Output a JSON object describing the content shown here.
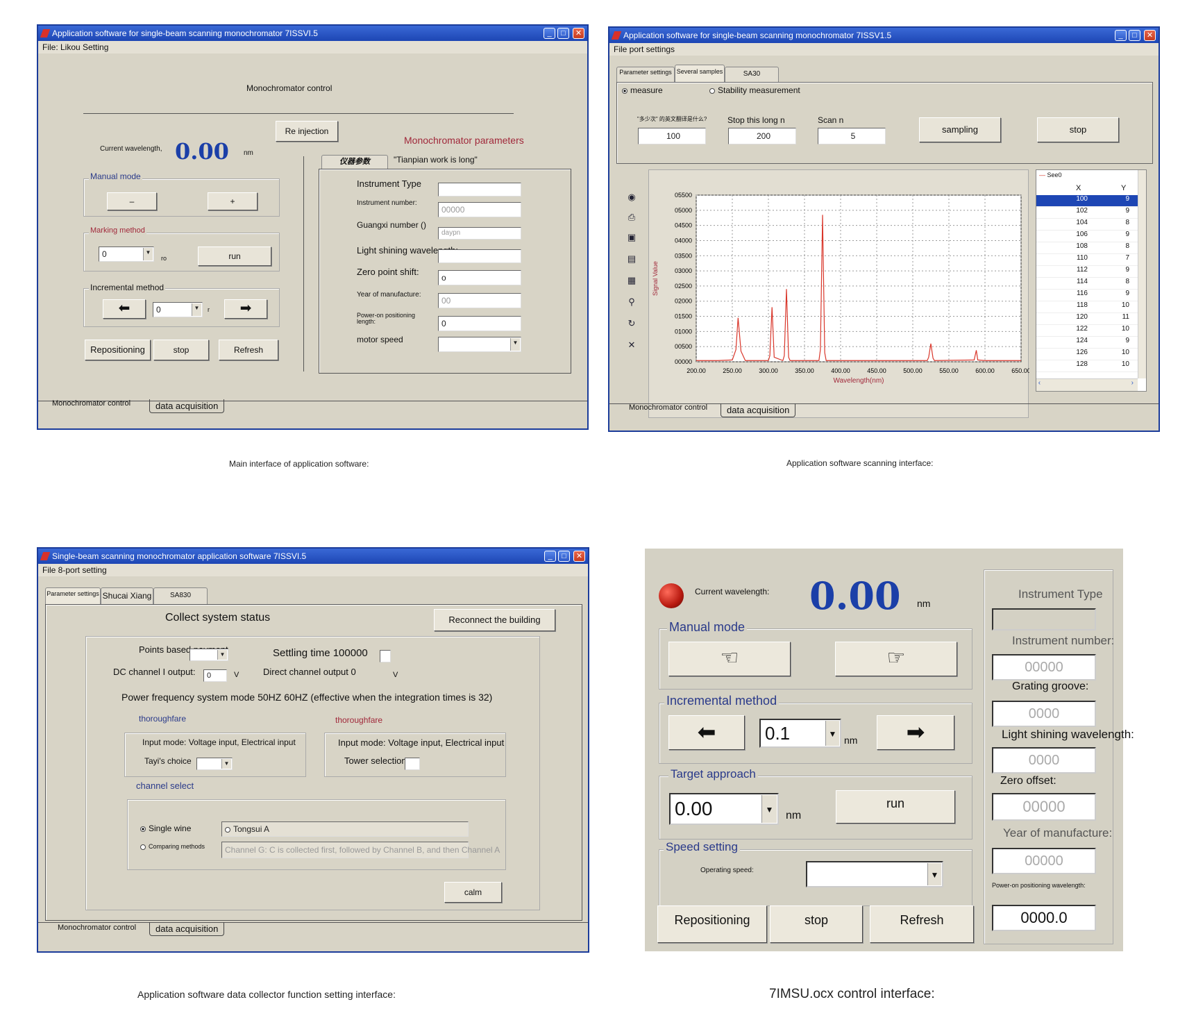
{
  "colors": {
    "titlebar": "#1d46b4",
    "wavelength": "#1b3fa8",
    "param_red": "#a0283a",
    "spectrum": "#d9362a",
    "group_blue": "#2a3a8a"
  },
  "panel1": {
    "title": "Application software for single-beam scanning monochromator 7ISSVI.5",
    "menu": "File: Likou Setting",
    "heading": "Monochromator control",
    "reinjection": "Re injection",
    "current_wavelength_label": "Current wavelength,",
    "wavelength_value": "0.00",
    "wavelength_unit": "nm",
    "manual_mode": "Manual mode",
    "minus": "–",
    "plus": "+",
    "marking_method": "Marking method",
    "marking_value": "0",
    "marking_unit": "ro",
    "run": "run",
    "incremental_method": "Incremental method",
    "incremental_value": "0",
    "incremental_unit": "r",
    "repositioning": "Repositioning",
    "stop": "stop",
    "refresh": "Refresh",
    "params_title": "Monochromator parameters",
    "tab_active": "仪器参数",
    "tab_other": "\"Tianpian work is long\"",
    "instrument_type": "Instrument Type",
    "instrument_number": "Instrument number:",
    "instrument_number_value": "00000",
    "guangxi_number": "Guangxi number ()",
    "guangxi_value": "daypn",
    "light_shining": "Light shining wavelength:",
    "zero_point": "Zero point shift:",
    "zero_point_value": "o",
    "year": "Year of manufacture:",
    "year_value": "00",
    "power_on": "Power-on positioning length:",
    "power_on_value": "0",
    "motor_speed": "motor speed",
    "bottom_tab1": "Monochromator control",
    "bottom_tab2": "data acquisition"
  },
  "caption1": "Main interface of application software:",
  "panel2": {
    "title": "Application software for single-beam scanning monochromator 7ISSV1.5",
    "menu": "File port settings",
    "tab1": "Parameter settings",
    "tab2": "Several samples",
    "tab3": "SA30",
    "radio_measure": "measure",
    "radio_stability": "Stability measurement",
    "field1_label": "\"多少次\" 的英文翻译是什么?",
    "field1_value": "100",
    "field2_label": "Stop this long n",
    "field2_value": "200",
    "field3_label": "Scan n",
    "field3_value": "5",
    "sampling": "sampling",
    "stop": "stop",
    "table_series": "See0",
    "table_col_x": "X",
    "table_col_y": "Y",
    "table_rows": [
      {
        "x": "100",
        "y": "9"
      },
      {
        "x": "102",
        "y": "9"
      },
      {
        "x": "104",
        "y": "8"
      },
      {
        "x": "106",
        "y": "9"
      },
      {
        "x": "108",
        "y": "8"
      },
      {
        "x": "110",
        "y": "7"
      },
      {
        "x": "112",
        "y": "9"
      },
      {
        "x": "114",
        "y": "8"
      },
      {
        "x": "116",
        "y": "9"
      },
      {
        "x": "118",
        "y": "10"
      },
      {
        "x": "120",
        "y": "11"
      },
      {
        "x": "122",
        "y": "10"
      },
      {
        "x": "124",
        "y": "9"
      },
      {
        "x": "126",
        "y": "10"
      },
      {
        "x": "128",
        "y": "10"
      }
    ],
    "bottom_tab1": "Monochromator control",
    "bottom_tab2": "data acquisition"
  },
  "chart_data": {
    "type": "line",
    "xlabel": "Wavelength(nm)",
    "ylabel": "Signal Value",
    "xlim": [
      200,
      650
    ],
    "ylim": [
      0,
      5500
    ],
    "x_ticks": [
      "200.00",
      "250.00",
      "300.00",
      "350.00",
      "400.00",
      "450.00",
      "500.00",
      "550.00",
      "600.00",
      "650.00"
    ],
    "y_ticks": [
      "05500",
      "05000",
      "04500",
      "04000",
      "03500",
      "03000",
      "02500",
      "02000",
      "01500",
      "01000",
      "00500",
      "00000"
    ],
    "grid": true,
    "series": [
      {
        "x": [
          200,
          230,
          250,
          255,
          258,
          262,
          268,
          280,
          300,
          302,
          305,
          308,
          320,
          322,
          325,
          328,
          330,
          360,
          370,
          372,
          375,
          378,
          380,
          400,
          450,
          520,
          522,
          525,
          528,
          530,
          585,
          588,
          590,
          600,
          650
        ],
        "y": [
          40,
          40,
          60,
          400,
          1450,
          350,
          40,
          40,
          40,
          200,
          1800,
          150,
          40,
          200,
          2400,
          150,
          40,
          40,
          40,
          400,
          4850,
          300,
          40,
          40,
          40,
          40,
          150,
          600,
          120,
          40,
          60,
          380,
          60,
          40,
          40
        ]
      }
    ]
  },
  "caption2": "Application software scanning interface:",
  "panel3": {
    "title": "Single-beam scanning monochromator application software 7ISSVI.5",
    "menu": "File 8-port setting",
    "tab1": "Parameter settings",
    "tab2": "Shucai Xiang",
    "tab3": "SA830",
    "collect_status": "Collect system status",
    "reconnect": "Reconnect the building",
    "points_based": "Points based payment",
    "settling_time": "Settling time 100000",
    "dc_channel": "DC channel I output:",
    "dc_value": "0",
    "dc_unit": "V",
    "direct_channel": "Direct channel output 0",
    "direct_unit": "V",
    "power_freq": "Power frequency system mode 50HZ 60HZ (effective when the integration times is 32)",
    "thoroughfare1": "thoroughfare",
    "thoroughfare2": "thoroughfare",
    "input_mode1": "Input mode: Voltage input, Electrical input",
    "input_mode2": "Input mode: Voltage input, Electrical input",
    "tayi_choice": "Tayi's choice",
    "tower_selection": "Tower selection",
    "channel_select": "channel select",
    "single_wine": "Single wine",
    "tongsui": "Tongsui A",
    "comparing": "Comparing methods",
    "channel_desc": "Channel G: C is collected first, followed by Channel B, and then Channel A",
    "calm": "calm",
    "bottom_tab1": "Monochromator control",
    "bottom_tab2": "data acquisition"
  },
  "caption3": "Application software data collector function setting interface:",
  "panel4": {
    "current_wavelength_label": "Current wavelength:",
    "wavelength_value": "0.00",
    "wavelength_unit": "nm",
    "manual_mode": "Manual mode",
    "incremental_method": "Incremental method",
    "incremental_value": "0.1",
    "incremental_unit": "nm",
    "target_approach": "Target approach",
    "target_value": "0.00",
    "target_unit": "nm",
    "run": "run",
    "speed_setting": "Speed setting",
    "operating_speed": "Operating speed:",
    "repositioning": "Repositioning",
    "stop": "stop",
    "refresh": "Refresh",
    "instrument_type": "Instrument Type",
    "instrument_number": "Instrument number:",
    "instrument_number_value": "00000",
    "grating_groove": "Grating groove:",
    "grating_value": "0000",
    "light_shining": "Light shining wavelength:",
    "light_value": "0000",
    "zero_offset": "Zero offset:",
    "zero_value": "00000",
    "year": "Year of manufacture:",
    "year_value": "00000",
    "power_on": "Power-on positioning wavelength:",
    "power_on_value": "0000.0"
  },
  "caption4": "7IMSU.ocx control interface:"
}
